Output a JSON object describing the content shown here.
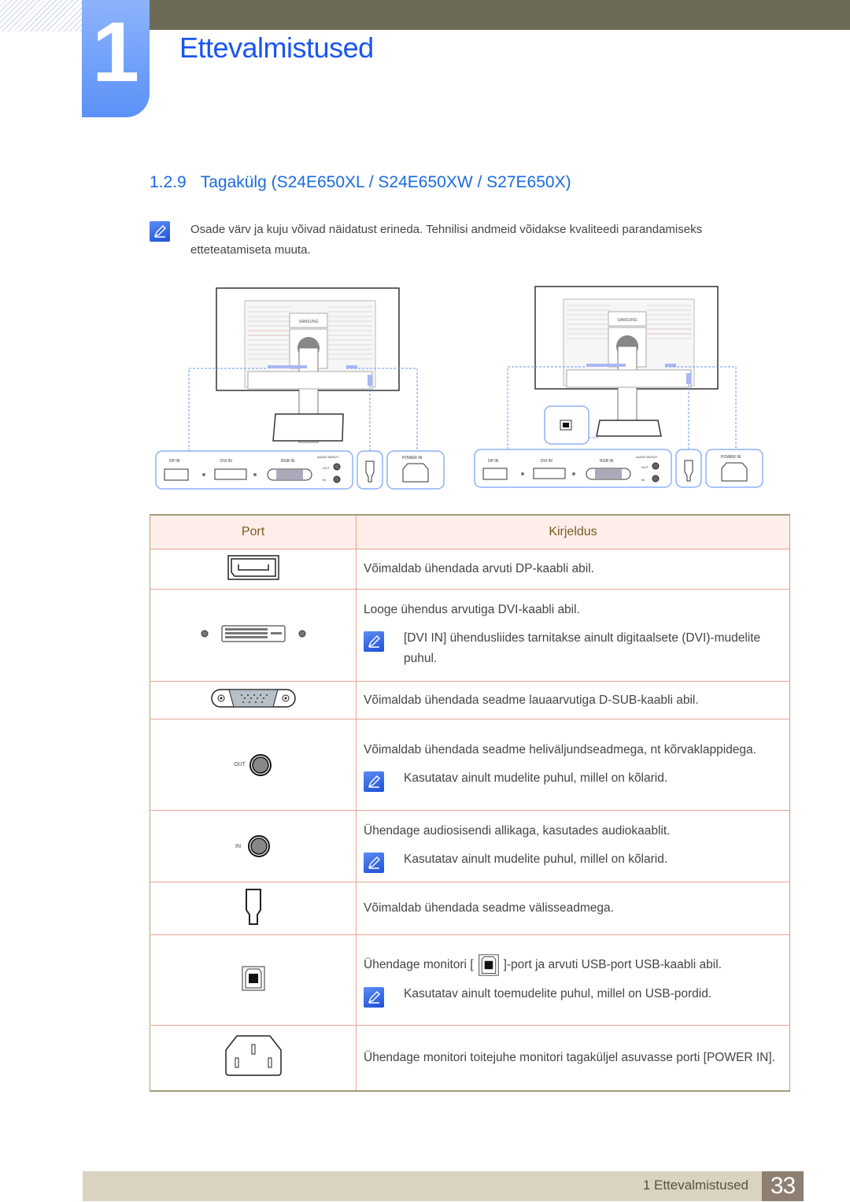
{
  "chapter": {
    "number": "1",
    "title": "Ettevalmistused"
  },
  "section": {
    "number": "1.2.9",
    "title": "Tagakülg (S24E650XL / S24E650XW / S27E650X)"
  },
  "intro_note": {
    "icon": "note-icon",
    "text": "Osade värv ja kuju võivad näidatust erineda. Tehnilisi andmeid võidakse kvaliteedi parandamiseks etteteatamiseta muuta."
  },
  "diagrams": {
    "left": {
      "brand": "SAMSUNG",
      "port_labels": {
        "dp": "DP IN",
        "dvi": "DVI IN",
        "rgb": "RGB IN",
        "audio": "AUDIO IN/OUT",
        "out": "OUT",
        "in": "IN",
        "power": "POWER IN"
      }
    },
    "right": {
      "brand": "SAMSUNG",
      "port_labels": {
        "dp": "DP IN",
        "dvi": "DVI IN",
        "rgb": "RGB IN",
        "audio": "AUDIO IN/OUT",
        "out": "OUT",
        "in": "IN",
        "power": "POWER IN"
      }
    }
  },
  "table": {
    "headers": [
      "Port",
      "Kirjeldus"
    ],
    "rows": [
      {
        "port_icon": "displayport-icon",
        "lines": [
          "Võimaldab ühendada arvuti DP-kaabli abil."
        ],
        "note": null
      },
      {
        "port_icon": "dvi-port-icon",
        "lines": [
          "Looge ühendus arvutiga DVI-kaabli abil."
        ],
        "note": "[DVI IN] ühendusliides tarnitakse ainult digitaalsete (DVI)-mudelite puhul."
      },
      {
        "port_icon": "vga-port-icon",
        "lines": [
          "Võimaldab ühendada seadme lauaarvutiga D-SUB-kaabli abil."
        ],
        "note": null
      },
      {
        "port_icon": "audio-out-icon",
        "port_label": "OUT",
        "lines": [
          "Võimaldab ühendada seadme heliväljundseadmega, nt kõrvaklappidega."
        ],
        "note": "Kasutatav ainult mudelite puhul, millel on kõlarid."
      },
      {
        "port_icon": "audio-in-icon",
        "port_label": "IN",
        "lines": [
          "Ühendage audiosisendi allikaga, kasutades audiokaablit."
        ],
        "note": "Kasutatav ainult mudelite puhul, millel on kõlarid."
      },
      {
        "port_icon": "kensington-lock-icon",
        "lines": [
          "Võimaldab ühendada seadme välisseadmega."
        ],
        "note": null
      },
      {
        "port_icon": "usb-b-port-icon",
        "lines_before": "Ühendage monitori [",
        "lines_after": "]-port ja arvuti USB-port USB-kaabli abil.",
        "note": "Kasutatav ainult toemudelite puhul, millel on USB-pordid."
      },
      {
        "port_icon": "power-in-icon",
        "lines": [
          "Ühendage monitori toitejuhe monitori tagaküljel asuvasse porti [POWER IN]."
        ],
        "note": null
      }
    ]
  },
  "footer": {
    "label": "1 Ettevalmistused",
    "page": "33"
  }
}
